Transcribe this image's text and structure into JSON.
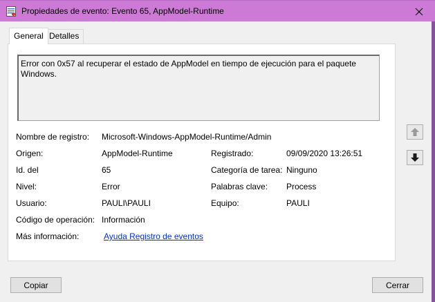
{
  "window": {
    "title": "Propiedades de evento: Evento 65, AppModel-Runtime",
    "accent": "#cc7ad6"
  },
  "tabs": [
    {
      "label": "General",
      "active": true
    },
    {
      "label": "Detalles",
      "active": false
    }
  ],
  "description": "Error con 0x57 al recuperar el estado de AppModel en tiempo de ejecución para el paquete Windows.",
  "fields": {
    "log_name": {
      "label": "Nombre de registro:",
      "value": "Microsoft-Windows-AppModel-Runtime/Admin"
    },
    "source": {
      "label": "Origen:",
      "value": "AppModel-Runtime"
    },
    "logged": {
      "label": "Registrado:",
      "value": "09/09/2020 13:26:51"
    },
    "event_id": {
      "label": "Id. del",
      "value": "65"
    },
    "task_category": {
      "label": "Categoría de tarea:",
      "value": "Ninguno"
    },
    "level": {
      "label": "Nivel:",
      "value": "Error"
    },
    "keywords": {
      "label": "Palabras clave:",
      "value": "Process"
    },
    "user": {
      "label": "Usuario:",
      "value": "PAULI\\PAULI"
    },
    "computer": {
      "label": "Equipo:",
      "value": "PAULI"
    },
    "opcode": {
      "label": "Código de operación:",
      "value": "Información"
    },
    "more_info": {
      "label": "Más información:",
      "value": "Ayuda Registro de eventos"
    }
  },
  "buttons": {
    "copy": "Copiar",
    "close": "Cerrar"
  },
  "icons": {
    "window_icon": "event-viewer-icon",
    "close": "close-icon",
    "up": "arrow-up-icon",
    "down": "arrow-down-icon"
  }
}
